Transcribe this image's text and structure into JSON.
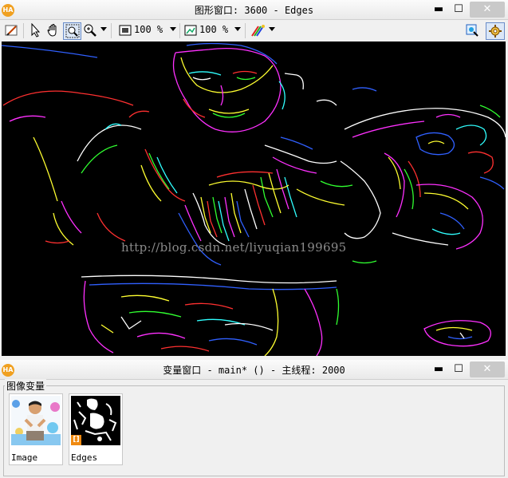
{
  "graphics_window": {
    "app_logo": "HA",
    "title": "图形窗口: 3600 - Edges",
    "min_glyph": "▬",
    "max_glyph": "☐",
    "close_glyph": "✕"
  },
  "toolbar": {
    "tools": [
      "brush-icon",
      "pointer-icon",
      "hand-pan-icon",
      "zoom-box-icon",
      "zoom-magnifier-icon",
      "zoom-fit-icon",
      "zoom-image-icon",
      "color-palette-icon",
      "feature-inspect-icon",
      "settings-icon"
    ],
    "zoom_window_value": "100 %",
    "zoom_image_value": "100 %"
  },
  "canvas": {
    "background": "#000000",
    "watermark": "http://blog.csdn.net/liyuqian199695"
  },
  "variable_window": {
    "app_logo": "HA",
    "title": "变量窗口 - main* () - 主线程: 2000",
    "min_glyph": "▬",
    "max_glyph": "☐",
    "close_glyph": "✕",
    "group_label": "图像变量",
    "thumbnails": [
      {
        "caption": "Image"
      },
      {
        "caption": "Edges",
        "badge": "[]"
      }
    ]
  },
  "colors": {
    "close_button": "#c9c9c9",
    "logo": "#f0a020",
    "edge_colors": [
      "#ff3030",
      "#30ff30",
      "#3060ff",
      "#ffff30",
      "#ff30ff",
      "#30ffff",
      "#ffffff"
    ]
  }
}
